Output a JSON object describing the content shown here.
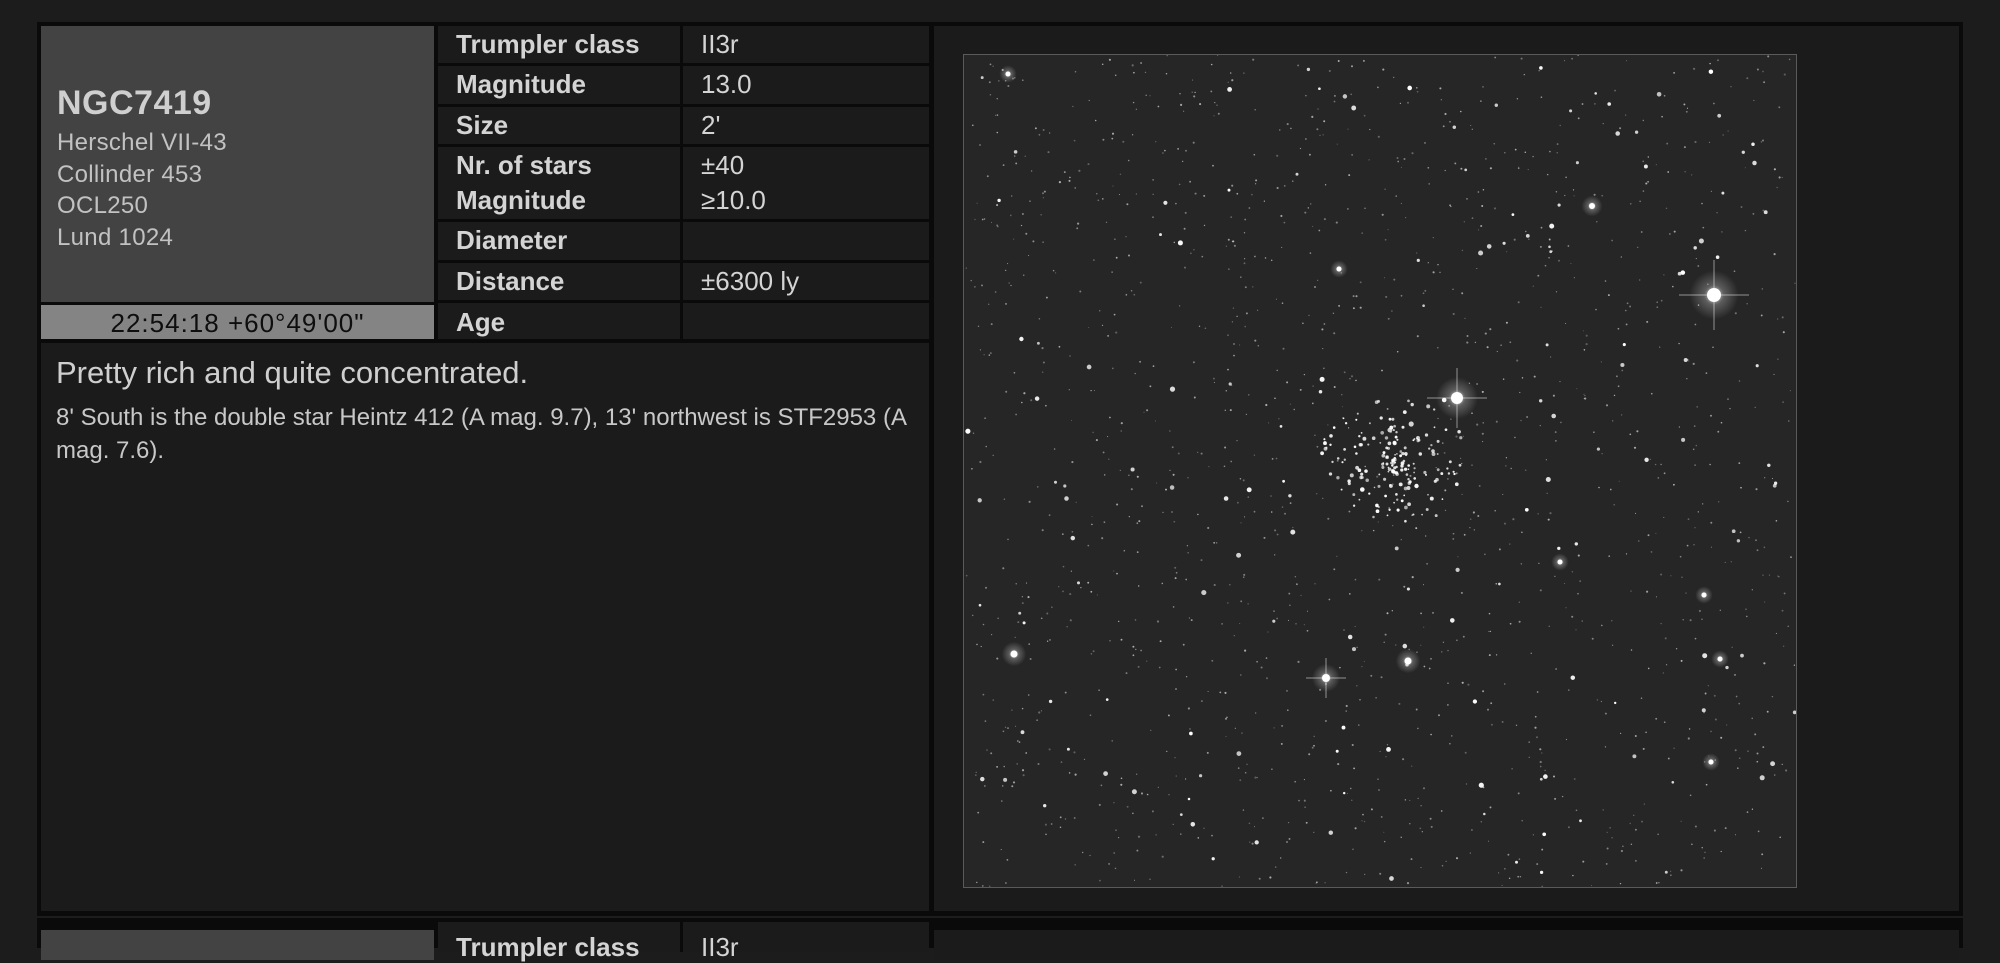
{
  "object": {
    "name": "NGC7419",
    "aliases": [
      "Herschel VII-43",
      "Collinder 453",
      "OCL250",
      "Lund 1024"
    ],
    "coordinates": "22:54:18 +60°49'00\""
  },
  "properties": [
    {
      "labels": [
        "Trumpler class"
      ],
      "values": [
        "II3r"
      ]
    },
    {
      "labels": [
        "Magnitude"
      ],
      "values": [
        "13.0"
      ]
    },
    {
      "labels": [
        "Size"
      ],
      "values": [
        "2'"
      ]
    },
    {
      "labels": [
        "Nr. of stars",
        "Magnitude"
      ],
      "values": [
        "±40",
        "≥10.0"
      ]
    },
    {
      "labels": [
        "Diameter"
      ],
      "values": [
        ""
      ]
    },
    {
      "labels": [
        "Distance"
      ],
      "values": [
        "±6300 ly"
      ]
    },
    {
      "labels": [
        "Age"
      ],
      "values": [
        ""
      ]
    }
  ],
  "description": {
    "headline": "Pretty rich and quite concentrated.",
    "body": "8' South is the double star Heintz 412 (A mag. 9.7), 13' northwest is STF2953 (A mag. 7.6)."
  },
  "next_card": {
    "label": "Trumpler class",
    "value": "II3r"
  }
}
